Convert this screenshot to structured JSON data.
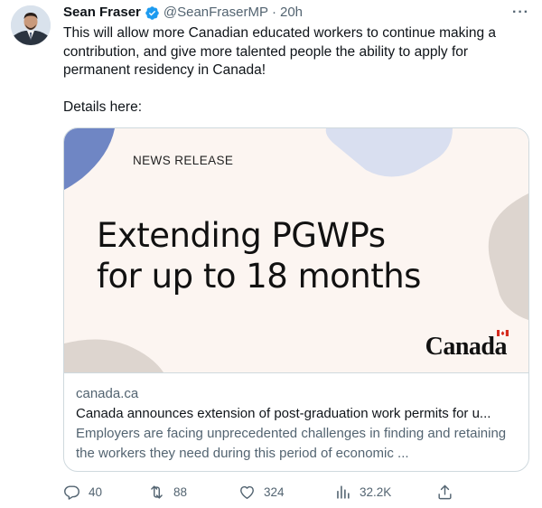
{
  "author": {
    "name": "Sean Fraser",
    "handle": "@SeanFraserMP",
    "separator": "·",
    "time": "20h",
    "verified": true
  },
  "tweet": {
    "text_line_1": "This will allow more Canadian educated workers to continue making a contribution, and give more talented people the ability to apply for permanent residency in Canada!",
    "text_line_2": "Details here:"
  },
  "card": {
    "label": "NEWS RELEASE",
    "headline_line_1": "Extending PGWPs",
    "headline_line_2": "for up to 18 months",
    "brand": "Canada",
    "domain": "canada.ca",
    "title": "Canada announces extension of post-graduation work permits for u...",
    "description": "Employers are facing unprecedented challenges in finding and retaining the workers they need during this period of economic ..."
  },
  "actions": {
    "replies": "40",
    "retweets": "88",
    "likes": "324",
    "views": "32.2K"
  },
  "colors": {
    "accent": "#1d9bf0",
    "muted_text": "#536471",
    "card_bg": "#fcf5f1",
    "shape_blue": "#6f86c4",
    "shape_light_blue": "#d9dff0",
    "shape_beige": "#ddd5cf",
    "flag_red": "#d52b1e"
  },
  "icons": {
    "verified": "verified-badge-icon",
    "more": "more-icon",
    "reply": "reply-icon",
    "retweet": "retweet-icon",
    "like": "heart-icon",
    "views": "views-icon",
    "share": "share-icon"
  }
}
